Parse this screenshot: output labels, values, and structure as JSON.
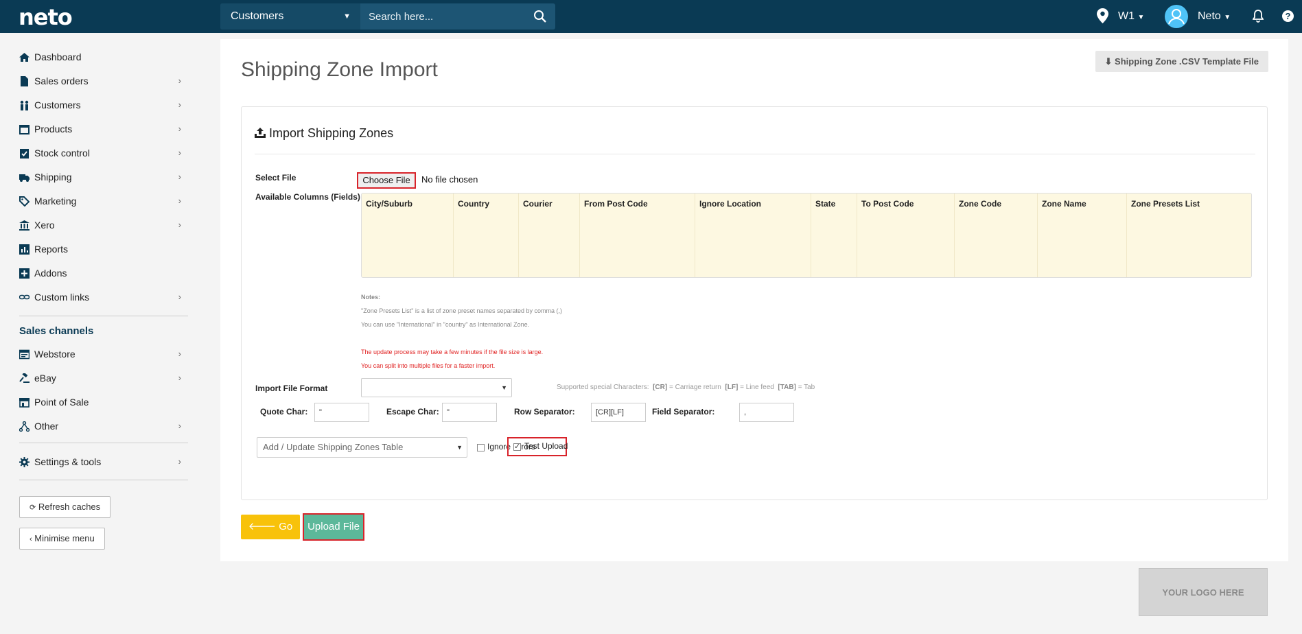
{
  "topbar": {
    "logo": "neto",
    "search_scope": "Customers",
    "search_placeholder": "Search here...",
    "location": "W1",
    "user": "Neto",
    "help": "?"
  },
  "sidebar": {
    "items": [
      {
        "label": "Dashboard",
        "icon": "home-icon"
      },
      {
        "label": "Sales orders",
        "icon": "file-icon"
      },
      {
        "label": "Customers",
        "icon": "people-icon"
      },
      {
        "label": "Products",
        "icon": "box-icon"
      },
      {
        "label": "Stock control",
        "icon": "clipboard-icon"
      },
      {
        "label": "Shipping",
        "icon": "truck-icon"
      },
      {
        "label": "Marketing",
        "icon": "tag-icon"
      },
      {
        "label": "Xero",
        "icon": "bank-icon"
      },
      {
        "label": "Reports",
        "icon": "bar-chart-icon"
      },
      {
        "label": "Addons",
        "icon": "plus-square-icon"
      },
      {
        "label": "Custom links",
        "icon": "link-icon"
      }
    ],
    "channels_heading": "Sales channels",
    "channels": [
      {
        "label": "Webstore",
        "icon": "webstore-icon"
      },
      {
        "label": "eBay",
        "icon": "gavel-icon"
      },
      {
        "label": "Point of Sale",
        "icon": "store-icon"
      },
      {
        "label": "Other",
        "icon": "share-icon"
      }
    ],
    "settings": "Settings & tools",
    "refresh": "Refresh caches",
    "minimise": "Minimise menu"
  },
  "main": {
    "title": "Shipping Zone Import",
    "template_button": "Shipping Zone .CSV Template File",
    "panel_title": "Import Shipping Zones",
    "select_file_label": "Select File",
    "choose_file": "Choose File",
    "no_file": "No file chosen",
    "available_label": "Available Columns (Fields)",
    "columns": [
      "City/Suburb",
      "Country",
      "Courier",
      "From Post Code",
      "Ignore Location",
      "State",
      "To Post Code",
      "Zone Code",
      "Zone Name",
      "Zone Presets List"
    ],
    "notes_heading": "Notes:",
    "note1": "\"Zone Presets List\" is a list of zone preset names separated by comma (,)",
    "note2": "You can use \"International\" in \"country\" as International Zone.",
    "warn1": "The update process may take a few minutes if the file size is large.",
    "warn2": "You can split into multiple files for a faster import.",
    "format_label": "Import File Format",
    "format_value": "",
    "special_label": "Supported special Characters:",
    "special_cr": "[CR]",
    "special_cr_desc": "= Carriage return",
    "special_lf": "[LF]",
    "special_lf_desc": "= Line feed",
    "special_tab": "[TAB]",
    "special_tab_desc": "= Tab",
    "quote_label": "Quote Char:",
    "quote_value": "\"",
    "escape_label": "Escape Char:",
    "escape_value": "\"",
    "row_label": "Row Separator:",
    "row_value": "[CR][LF]",
    "field_label": "Field Separator:",
    "field_value": ",",
    "action_value": "Add / Update Shipping Zones Table",
    "ignore_errors": "Ignore Errors",
    "test_upload": "Test Upload",
    "go_back": "Go Back",
    "upload": "Upload File"
  },
  "footer": {
    "logo_placeholder": "YOUR LOGO HERE"
  }
}
